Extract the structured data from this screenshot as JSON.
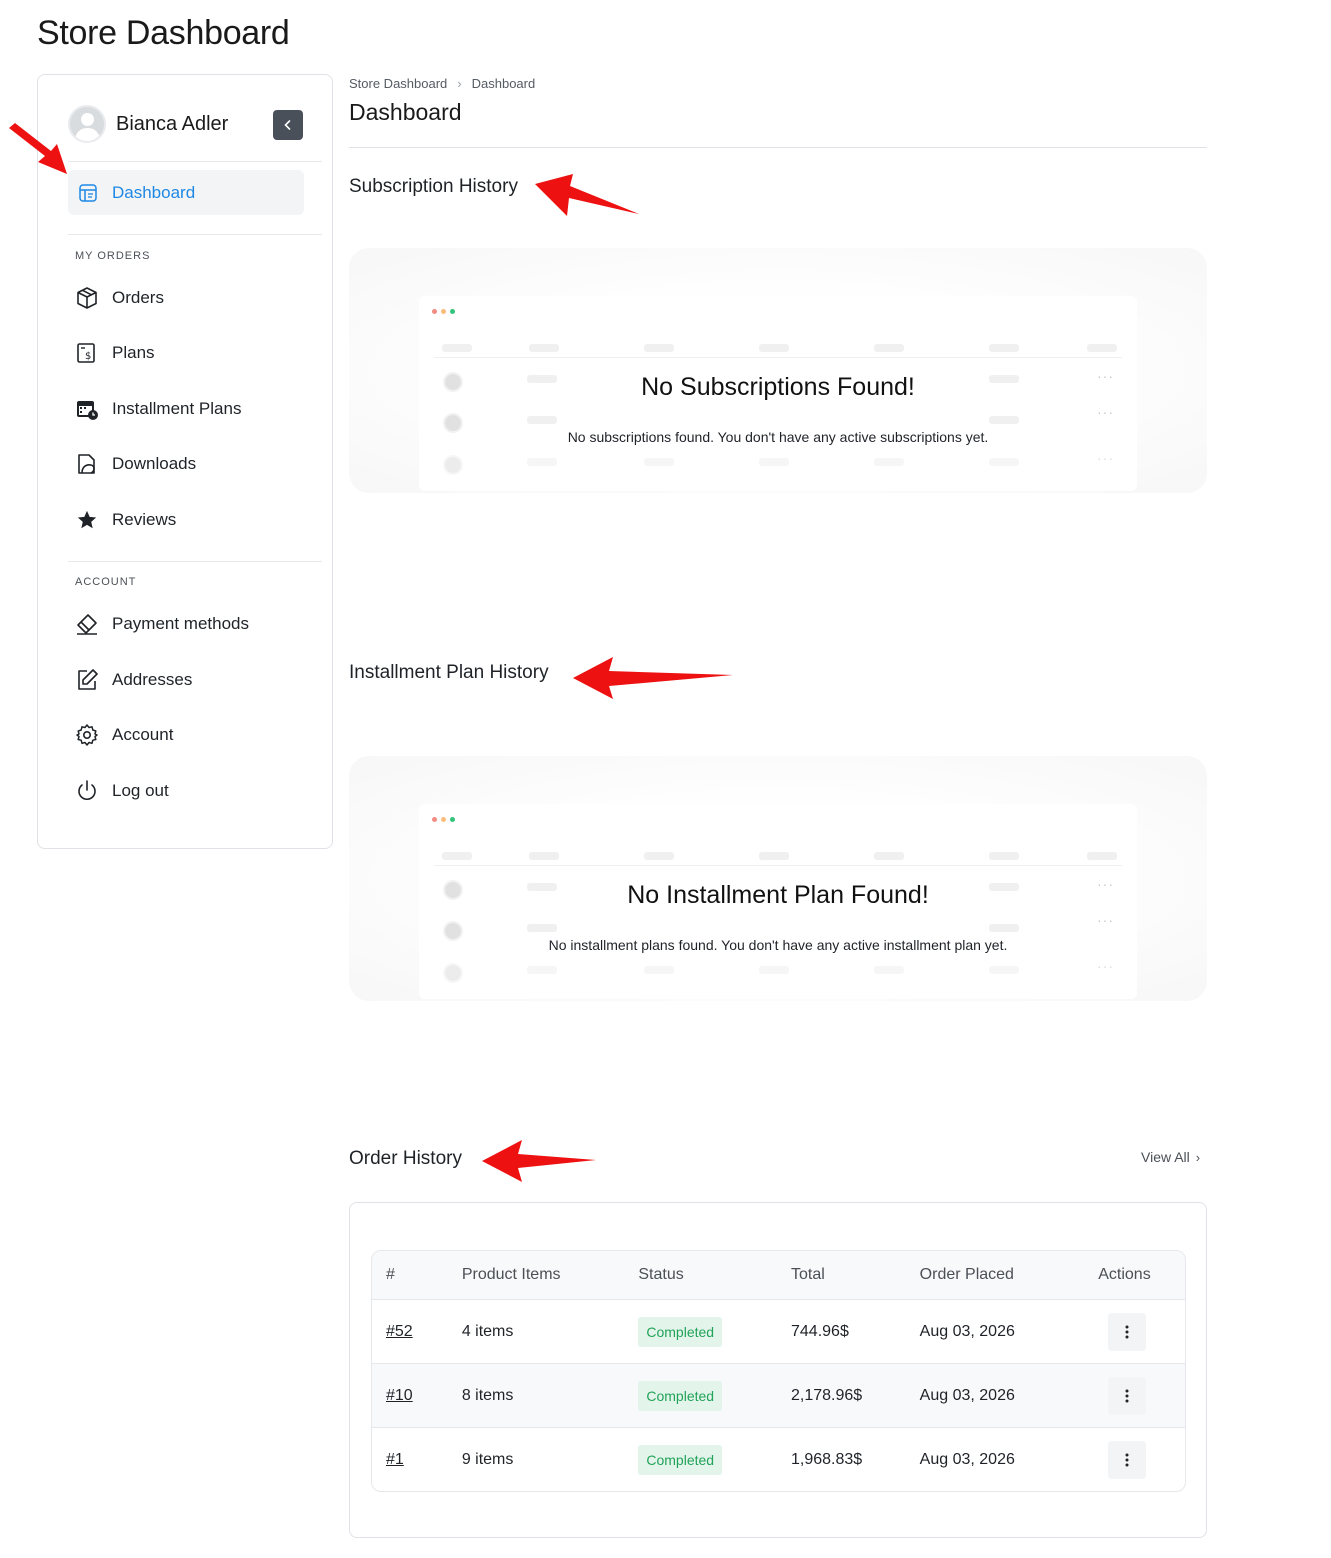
{
  "page": {
    "title": "Store Dashboard"
  },
  "sidebar": {
    "user_name": "Bianca Adler",
    "active_item": "Dashboard",
    "sections": [
      {
        "label": "MY ORDERS",
        "items": [
          "Orders",
          "Plans",
          "Installment Plans",
          "Downloads",
          "Reviews"
        ]
      },
      {
        "label": "ACCOUNT",
        "items": [
          "Payment methods",
          "Addresses",
          "Account",
          "Log out"
        ]
      }
    ]
  },
  "breadcrumb": [
    "Store Dashboard",
    "Dashboard"
  ],
  "main": {
    "title": "Dashboard",
    "subscription": {
      "heading": "Subscription History",
      "empty_title": "No Subscriptions Found!",
      "empty_desc": "No subscriptions found. You don't have any active subscriptions yet."
    },
    "installment": {
      "heading": "Installment Plan History",
      "empty_title": "No Installment Plan Found!",
      "empty_desc": "No installment plans found. You don't have any active installment plan yet."
    },
    "orders": {
      "heading": "Order History",
      "view_all": "View All",
      "columns": [
        "#",
        "Product Items",
        "Status",
        "Total",
        "Order Placed",
        "Actions"
      ],
      "rows": [
        {
          "id": "#52",
          "items": "4 items",
          "status": "Completed",
          "total": "744.96$",
          "date": "Aug 03, 2026"
        },
        {
          "id": "#10",
          "items": "8 items",
          "status": "Completed",
          "total": "2,178.96$",
          "date": "Aug 03, 2026"
        },
        {
          "id": "#1",
          "items": "9 items",
          "status": "Completed",
          "total": "1,968.83$",
          "date": "Aug 03, 2026"
        }
      ]
    }
  },
  "colors": {
    "accent": "#1e88e5",
    "success": "#22a25a",
    "success_bg": "#e3f5ea",
    "annotation_arrow": "#ee1111"
  }
}
